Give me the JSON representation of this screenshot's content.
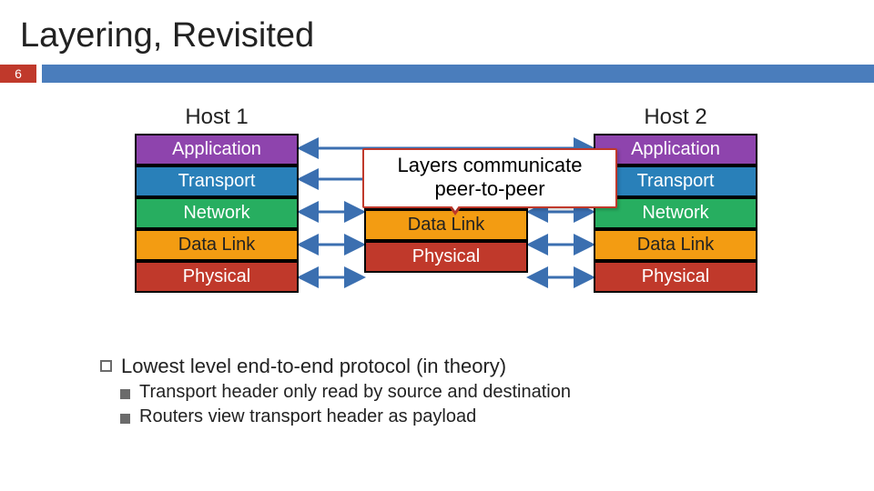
{
  "slide_title": "Layering, Revisited",
  "page_number": "6",
  "columns": {
    "host1_title": "Host 1",
    "host2_title": "Host 2"
  },
  "layers": {
    "application": "Application",
    "transport": "Transport",
    "network": "Network",
    "datalink": "Data Link",
    "physical": "Physical"
  },
  "callout_line1": "Layers communicate",
  "callout_line2": "peer-to-peer",
  "notes": {
    "main": "Lowest level end-to-end protocol (in theory)",
    "sub1": "Transport header only read by source and destination",
    "sub2": "Routers view transport header as payload"
  }
}
